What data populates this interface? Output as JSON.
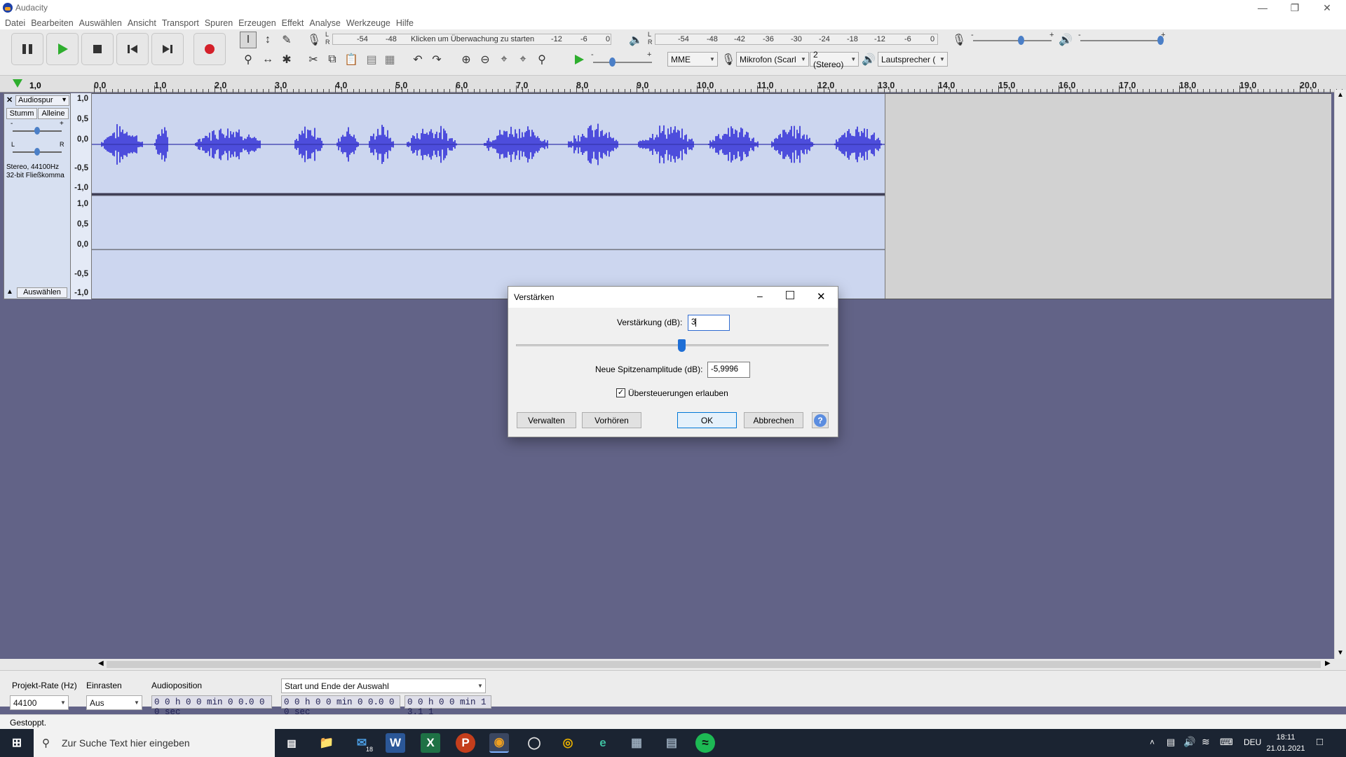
{
  "window": {
    "title": "Audacity"
  },
  "menu": [
    "Datei",
    "Bearbeiten",
    "Auswählen",
    "Ansicht",
    "Transport",
    "Spuren",
    "Erzeugen",
    "Effekt",
    "Analyse",
    "Werkzeuge",
    "Hilfe"
  ],
  "meters": {
    "rec_scale": [
      "-54",
      "-48"
    ],
    "monitor_hint": "Klicken um Überwachung zu starten",
    "rec_scale2": [
      "-12",
      "-6",
      "0"
    ],
    "play_scale": [
      "-54",
      "-48",
      "-42",
      "-36",
      "-30",
      "-24",
      "-18",
      "-12",
      "-6",
      "0"
    ],
    "lr": {
      "l": "L",
      "r": "R"
    },
    "minus": "-",
    "plus": "+"
  },
  "devices": {
    "host": "MME",
    "mic": "Mikrofon (Scarl",
    "channels": "2 (Stereo)",
    "speaker": "Lautsprecher ("
  },
  "ruler": {
    "start": "1,0",
    "ticks": [
      "0,0",
      "1,0",
      "2,0",
      "3,0",
      "4,0",
      "5,0",
      "6,0",
      "7,0",
      "8,0",
      "9,0",
      "10,0",
      "11,0",
      "12,0",
      "13,0",
      "14,0",
      "15,0",
      "16,0",
      "17,0",
      "18,0",
      "19,0",
      "20,0"
    ]
  },
  "track": {
    "name": "Audiospur",
    "mute": "Stumm",
    "solo": "Alleine",
    "gain_minus": "-",
    "gain_plus": "+",
    "pan_l": "L",
    "pan_r": "R",
    "info1": "Stereo, 44100Hz",
    "info2": "32-bit Fließkomma",
    "select": "Auswählen",
    "scale": [
      "1,0",
      "0,5",
      "0,0",
      "-0,5",
      "-1,0"
    ]
  },
  "dialog": {
    "title": "Verstärken",
    "gain_label": "Verstärkung (dB):",
    "gain_value": "3",
    "gain_slider": 0.53,
    "peak_label": "Neue Spitzenamplitude (dB):",
    "peak_value": "-5,9996",
    "clip_label": "Übersteuerungen erlauben",
    "clip_checked": true,
    "manage": "Verwalten",
    "preview": "Vorhören",
    "ok": "OK",
    "cancel": "Abbrechen",
    "help": "?"
  },
  "selection": {
    "rate_label": "Projekt-Rate (Hz)",
    "rate_value": "44100",
    "snap_label": "Einrasten",
    "snap_value": "Aus",
    "pos_label": "Audioposition",
    "pos_value": "0 0 h 0 0 min 0 0.0 0 0 sec",
    "range_label": "Start und Ende der Auswahl",
    "start_value": "0 0 h 0 0 min 0 0.0 0 0 sec",
    "end_value": "0 0 h 0 0 min 1 3.1 1"
  },
  "status": "Gestoppt.",
  "taskbar": {
    "search": "Zur Suche Text hier eingeben",
    "mail_badge": "18",
    "lang": "DEU",
    "time": "18:11",
    "date": "21.01.2021"
  },
  "colors": {
    "wave": "#4d4ddc",
    "track_bg": "#ccd6ef",
    "workspace": "#626387",
    "record": "#d4202a",
    "play": "#2eae2e"
  }
}
